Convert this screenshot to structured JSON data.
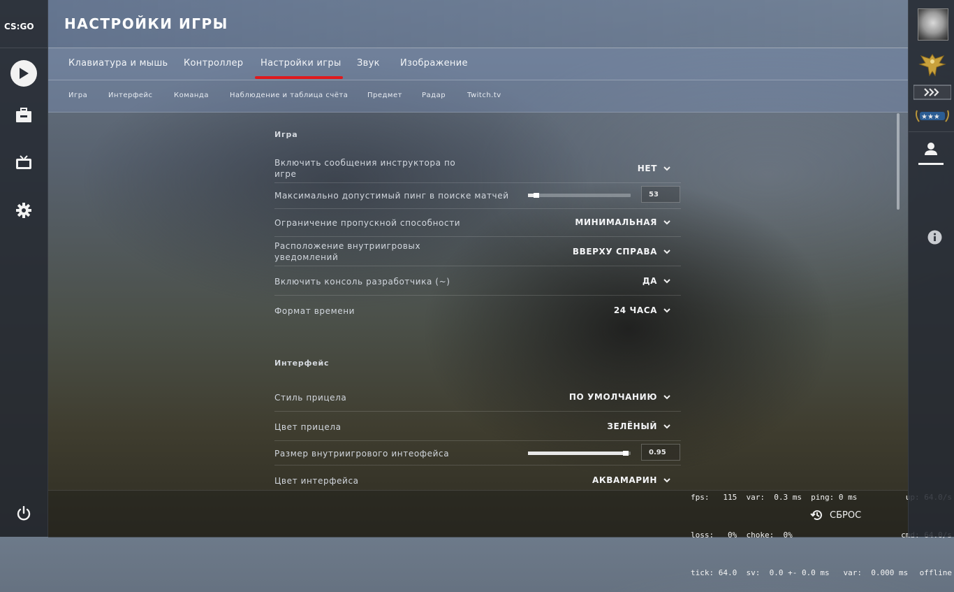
{
  "app": {
    "logo_text": "CS:GO"
  },
  "header": {
    "title": "НАСТРОЙКИ ИГРЫ"
  },
  "tabs": [
    {
      "label": "Клавиатура и мышь"
    },
    {
      "label": "Контроллер"
    },
    {
      "label": "Настройки игры",
      "active": true
    },
    {
      "label": "Звук"
    },
    {
      "label": "Изображение"
    }
  ],
  "subtabs": [
    {
      "label": "Игра"
    },
    {
      "label": "Интерфейс"
    },
    {
      "label": "Команда"
    },
    {
      "label": "Наблюдение и таблица счёта"
    },
    {
      "label": "Предмет"
    },
    {
      "label": "Радар"
    },
    {
      "label": "Twitch.tv"
    }
  ],
  "sections": {
    "game": {
      "title": "Игра",
      "rows": [
        {
          "label": "Включить сообщения инструктора по игре",
          "value": "НЕТ"
        },
        {
          "label": "Максимально допустимый пинг в поиске матчей",
          "value": "53",
          "slider_fraction": 0.08
        },
        {
          "label": "Ограничение пропускной способности",
          "value": "МИНИМАЛЬНАЯ"
        },
        {
          "label": "Расположение внутриигровых уведомлений",
          "value": "ВВЕРХУ СПРАВА"
        },
        {
          "label": "Включить консоль разработчика (~)",
          "value": "ДА"
        },
        {
          "label": "Формат времени",
          "value": "24 ЧАСА"
        }
      ]
    },
    "interface": {
      "title": "Интерфейс",
      "rows": [
        {
          "label": "Стиль прицела",
          "value": "ПО УМОЛЧАНИЮ"
        },
        {
          "label": "Цвет прицела",
          "value": "ЗЕЛЁНЫЙ"
        },
        {
          "label": "Размер внутриигрового интеофейса",
          "value": "0.95",
          "slider_fraction": 0.95
        },
        {
          "label": "Цвет интерфейса",
          "value": "АКВАМАРИН"
        }
      ]
    }
  },
  "footer": {
    "reset_label": "СБРОС"
  },
  "netgraph": {
    "line1": "fps:   115  var:  0.3 ms  ping: 0 ms",
    "line2": "loss:   0%  choke:  0%",
    "line3": "tick: 64.0  sv:  0.0 +- 0.0 ms   var:  0.000 ms",
    "right1": "up: 64.0/s",
    "right2": "cmd: 64.0/s",
    "right3": "offline"
  },
  "icons": {
    "play": "play-icon",
    "inventory": "briefcase-icon",
    "watch": "tv-icon",
    "settings": "gear-icon",
    "power": "power-icon",
    "friends": "person-icon",
    "info": "info-icon",
    "reset": "history-icon"
  },
  "colors": {
    "accent_red": "#e0191d",
    "text_light": "#f3f5f8"
  }
}
